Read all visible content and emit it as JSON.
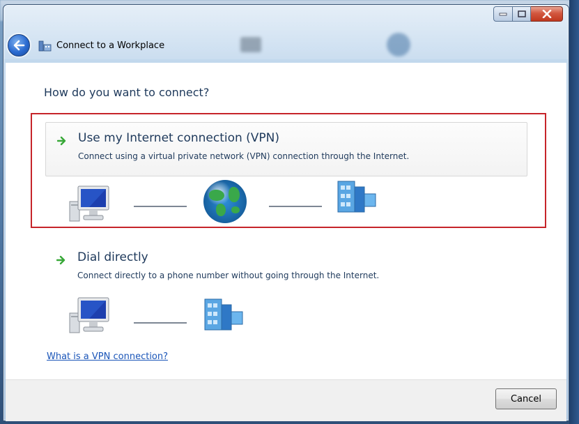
{
  "window": {
    "title": "Connect to a Workplace"
  },
  "main": {
    "heading": "How do you want to connect?",
    "options": [
      {
        "label": "Use my Internet connection (VPN)",
        "description": "Connect using a virtual private network (VPN) connection through the Internet.",
        "icon": "arrow-right-icon",
        "diagram": [
          "computer-icon",
          "globe-icon",
          "server-icon"
        ],
        "highlighted": true
      },
      {
        "label": "Dial directly",
        "description": "Connect directly to a phone number without going through the Internet.",
        "icon": "arrow-right-icon",
        "diagram": [
          "computer-icon",
          "server-icon"
        ],
        "highlighted": false
      }
    ],
    "help_link": "What is a VPN connection?"
  },
  "footer": {
    "cancel_label": "Cancel"
  },
  "colors": {
    "highlight_border": "#c6242a",
    "text_primary": "#1e395b",
    "link": "#1a55b8",
    "arrow": "#38a838"
  }
}
